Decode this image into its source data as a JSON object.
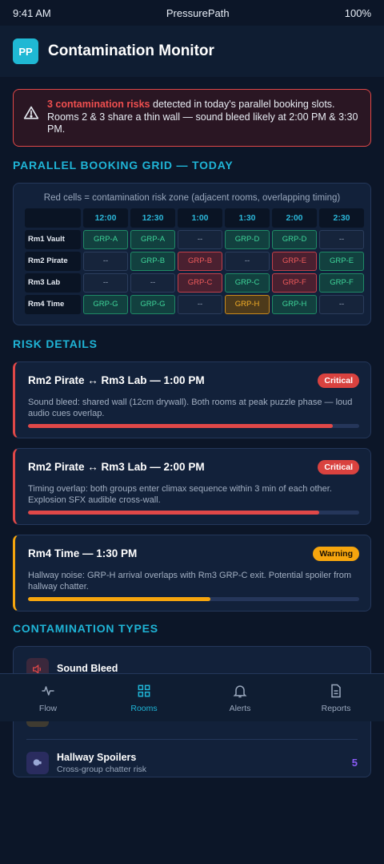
{
  "status": {
    "time": "9:41 AM",
    "app": "PressurePath",
    "battery": "100%"
  },
  "header": {
    "logo": "PP",
    "title": "Contamination Monitor"
  },
  "alert": {
    "icon": "warning-triangle-icon",
    "strong": "3 contamination risks",
    "text": " detected in today's parallel booking slots. Rooms 2 & 3 share a thin wall — sound bleed likely at 2:00 PM & 3:30 PM."
  },
  "grid": {
    "section_title": "PARALLEL BOOKING GRID — TODAY",
    "legend": "Red cells = contamination risk zone (adjacent rooms, overlapping timing)",
    "times": [
      "12:00",
      "12:30",
      "1:00",
      "1:30",
      "2:00",
      "2:30"
    ],
    "rows": [
      {
        "room": "Rm1 Vault",
        "cells": [
          {
            "t": "GRP-A",
            "s": "green"
          },
          {
            "t": "GRP-A",
            "s": "green"
          },
          {
            "t": "--",
            "s": "empty"
          },
          {
            "t": "GRP-D",
            "s": "green"
          },
          {
            "t": "GRP-D",
            "s": "green"
          },
          {
            "t": "--",
            "s": "empty"
          }
        ]
      },
      {
        "room": "Rm2 Pirate",
        "cells": [
          {
            "t": "--",
            "s": "empty"
          },
          {
            "t": "GRP-B",
            "s": "green"
          },
          {
            "t": "GRP-B",
            "s": "red"
          },
          {
            "t": "--",
            "s": "empty"
          },
          {
            "t": "GRP-E",
            "s": "red"
          },
          {
            "t": "GRP-E",
            "s": "green"
          }
        ]
      },
      {
        "room": "Rm3 Lab",
        "cells": [
          {
            "t": "--",
            "s": "empty"
          },
          {
            "t": "--",
            "s": "empty"
          },
          {
            "t": "GRP-C",
            "s": "red"
          },
          {
            "t": "GRP-C",
            "s": "green"
          },
          {
            "t": "GRP-F",
            "s": "red"
          },
          {
            "t": "GRP-F",
            "s": "green"
          }
        ]
      },
      {
        "room": "Rm4 Time",
        "cells": [
          {
            "t": "GRP-G",
            "s": "green"
          },
          {
            "t": "GRP-G",
            "s": "green"
          },
          {
            "t": "--",
            "s": "empty"
          },
          {
            "t": "GRP-H",
            "s": "orange"
          },
          {
            "t": "GRP-H",
            "s": "green"
          },
          {
            "t": "--",
            "s": "empty"
          }
        ]
      }
    ]
  },
  "risks": {
    "section_title": "RISK DETAILS",
    "items": [
      {
        "title": "Rm2 Pirate ↔ Rm3 Lab — 1:00 PM",
        "badge": "Critical",
        "level": "critical",
        "desc": "Sound bleed: shared wall (12cm drywall). Both rooms at peak puzzle phase — loud audio cues overlap.",
        "severity": 0.92
      },
      {
        "title": "Rm2 Pirate ↔ Rm3 Lab — 2:00 PM",
        "badge": "Critical",
        "level": "critical",
        "desc": "Timing overlap: both groups enter climax sequence within 3 min of each other. Explosion SFX audible cross-wall.",
        "severity": 0.88
      },
      {
        "title": "Rm4 Time — 1:30 PM",
        "badge": "Warning",
        "level": "warning",
        "desc": "Hallway noise: GRP-H arrival overlaps with Rm3 GRP-C exit. Potential spoiler from hallway chatter.",
        "severity": 0.55
      }
    ]
  },
  "types": {
    "section_title": "CONTAMINATION TYPES",
    "items": [
      {
        "name": "Sound Bleed",
        "sub": "",
        "count": "",
        "icon": "speaker-icon",
        "color": "#e04848"
      },
      {
        "name": "",
        "sub": "",
        "count": "",
        "icon": "clock-icon",
        "color": "#f5a50e"
      },
      {
        "name": "Hallway Spoilers",
        "sub": "Cross-group chatter risk",
        "count": "5",
        "icon": "chat-icon",
        "color": "#8b5cf6"
      }
    ]
  },
  "tabs": [
    {
      "label": "Flow",
      "icon": "pulse-icon",
      "active": false
    },
    {
      "label": "Rooms",
      "icon": "grid-icon",
      "active": true
    },
    {
      "label": "Alerts",
      "icon": "bell-icon",
      "active": false
    },
    {
      "label": "Reports",
      "icon": "document-icon",
      "active": false
    }
  ]
}
